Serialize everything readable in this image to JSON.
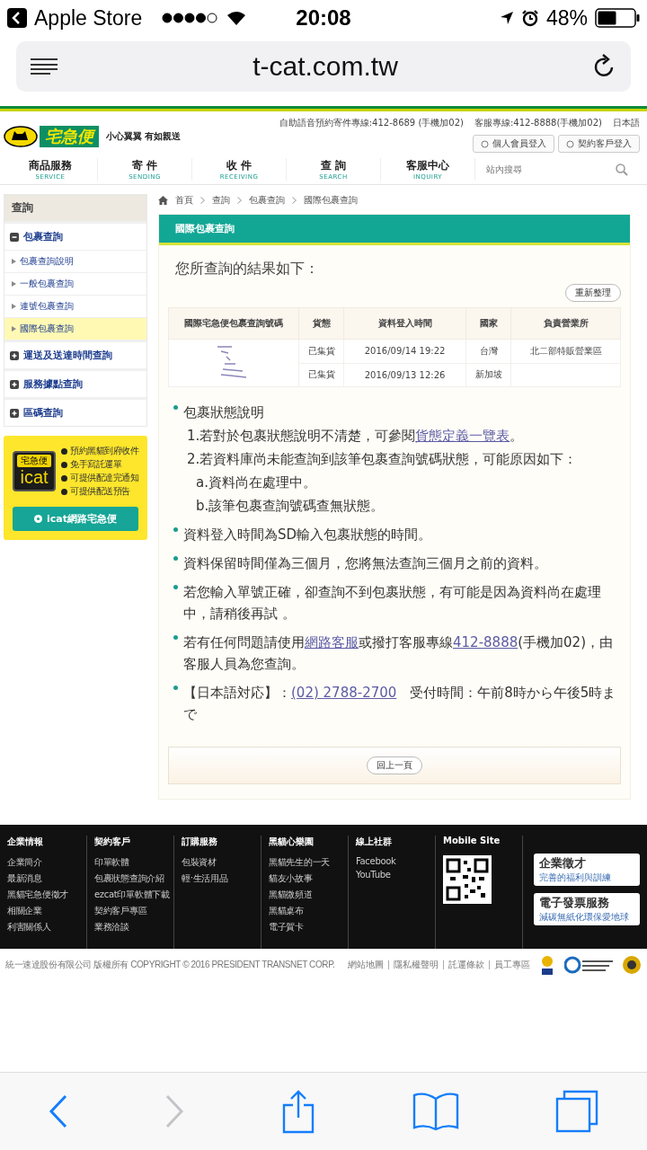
{
  "status_bar": {
    "back_app": "Apple Store",
    "time": "20:08",
    "battery": "48%"
  },
  "browser": {
    "url": "t-cat.com.tw"
  },
  "site_header": {
    "logo_text": "宅急便",
    "tagline": "小心翼翼 有如親送",
    "top_links": [
      "自助語音預約寄件專線:412-8689 (手機加02)",
      "客服專線:412-8888(手機加02)",
      "日本語"
    ],
    "login_buttons": [
      "個人會員登入",
      "契約客戶登入"
    ],
    "nav": [
      {
        "label": "商品服務",
        "sublabel": "SERVICE"
      },
      {
        "label": "寄 件",
        "sublabel": "SENDING"
      },
      {
        "label": "收 件",
        "sublabel": "RECEIVING"
      },
      {
        "label": "查 詢",
        "sublabel": "SEARCH"
      },
      {
        "label": "客服中心",
        "sublabel": "INQUIRY"
      }
    ],
    "search": {
      "placeholder": "站內搜尋"
    }
  },
  "sidebar": {
    "title": "查詢",
    "sections": [
      {
        "label": "包裹查詢",
        "expanded": true,
        "children": [
          {
            "label": "包裹查詢說明",
            "selected": false
          },
          {
            "label": "一般包裹查詢",
            "selected": false
          },
          {
            "label": "連號包裹查詢",
            "selected": false
          },
          {
            "label": "國際包裹查詢",
            "selected": true
          }
        ]
      },
      {
        "label": "運送及送達時間查詢",
        "expanded": false
      },
      {
        "label": "服務據點查詢",
        "expanded": false
      },
      {
        "label": "區碼查詢",
        "expanded": false
      }
    ]
  },
  "icat_promo": {
    "logo_brand": "宅急便",
    "logo_text": "icat",
    "features": [
      "預約黑貓到府收件",
      "免手寫託運單",
      "可提供配達完通知",
      "可提供配送預告"
    ],
    "button": "icat網路宅急便"
  },
  "breadcrumb": [
    "首頁",
    "查詢",
    "包裹查詢",
    "國際包裹查詢"
  ],
  "panel": {
    "title": "國際包裹查詢",
    "result_heading": "您所查詢的結果如下：",
    "refresh_button": "重新整理",
    "table": {
      "columns": [
        "國際宅急便包裹查詢號碼",
        "貨態",
        "資料登入時間",
        "國家",
        "負責營業所"
      ],
      "rows": [
        {
          "status": "已集貨",
          "time": "2016/09/14 19:22",
          "country": "台灣",
          "office": "北二部特販營業區"
        },
        {
          "status": "已集貨",
          "time": "2016/09/13 12:26",
          "country": "新加坡"
        }
      ]
    },
    "notes": [
      {
        "parts": [
          {
            "kind": "text",
            "text": "包裹狀態說明"
          }
        ],
        "children": [
          {
            "parts": [
              {
                "kind": "text",
                "text": "1.若對於包裹狀態說明不清楚，可參閱"
              },
              {
                "kind": "link",
                "text": "貨態定義一覽表"
              },
              {
                "kind": "text",
                "text": "。"
              }
            ]
          },
          {
            "parts": [
              {
                "kind": "text",
                "text": "2.若資料庫尚未能查詢到該筆包裹查詢號碼狀態，可能原因如下："
              }
            ],
            "children": [
              {
                "parts": [
                  {
                    "kind": "text",
                    "text": "a.資料尚在處理中。"
                  }
                ]
              },
              {
                "parts": [
                  {
                    "kind": "text",
                    "text": "b.該筆包裹查詢號碼查無狀態。"
                  }
                ]
              }
            ]
          }
        ]
      },
      {
        "parts": [
          {
            "kind": "text",
            "text": "資料登入時間為SD輸入包裹狀態的時間。"
          }
        ]
      },
      {
        "parts": [
          {
            "kind": "text",
            "text": "資料保留時間僅為三個月，您將無法查詢三個月之前的資料。"
          }
        ]
      },
      {
        "parts": [
          {
            "kind": "text",
            "text": "若您輸入單號正確，卻查詢不到包裹狀態，有可能是因為資料尚在處理中，請稍後再試 。"
          }
        ]
      },
      {
        "parts": [
          {
            "kind": "text",
            "text": "若有任何問題請使用"
          },
          {
            "kind": "link",
            "text": "網路客服"
          },
          {
            "kind": "text",
            "text": "或撥打客服專線"
          },
          {
            "kind": "link",
            "text": "412-8888"
          },
          {
            "kind": "text",
            "text": "(手機加02)，由客服人員為您查詢。"
          }
        ]
      },
      {
        "parts": [
          {
            "kind": "text",
            "text": "【日本語対応】："
          },
          {
            "kind": "link",
            "text": "(02) 2788-2700"
          },
          {
            "kind": "text",
            "text": "　受付時間：午前8時から午後5時まで"
          }
        ]
      }
    ],
    "back_button": "回上一頁"
  },
  "footer": {
    "columns": [
      {
        "title": "企業情報",
        "links": [
          "企業簡介",
          "最新消息",
          "黑貓宅急便徵才",
          "相關企業",
          "利害關係人"
        ]
      },
      {
        "title": "契約客戶",
        "links": [
          "印單軟體",
          "包裹狀態查詢介紹",
          "ezcat印單軟體下載",
          "契約客戶專區",
          "業務洽談"
        ]
      },
      {
        "title": "訂購服務",
        "links": [
          "包裝資材",
          "輕‧生活用品"
        ]
      },
      {
        "title": "黑貓心樂園",
        "links": [
          "黑貓先生的一天",
          "貓友小故事",
          "黑貓微頻道",
          "黑貓桌布",
          "電子賀卡"
        ]
      },
      {
        "title": "線上社群",
        "links": [
          "Facebook",
          "YouTube"
        ]
      }
    ],
    "mobile_site": "Mobile Site",
    "cards": [
      {
        "title": "企業徵才",
        "subtitle": "完善的福利與訓練"
      },
      {
        "title": "電子發票服務",
        "subtitle": "減碳無紙化環保愛地球"
      }
    ],
    "copyright": "統一速達股份有限公司 版權所有 COPYRIGHT © 2016 PRESIDENT TRANSNET CORP.",
    "bottom_links": [
      "網站地圖",
      "隱私權聲明",
      "託運條款",
      "員工專區"
    ]
  }
}
